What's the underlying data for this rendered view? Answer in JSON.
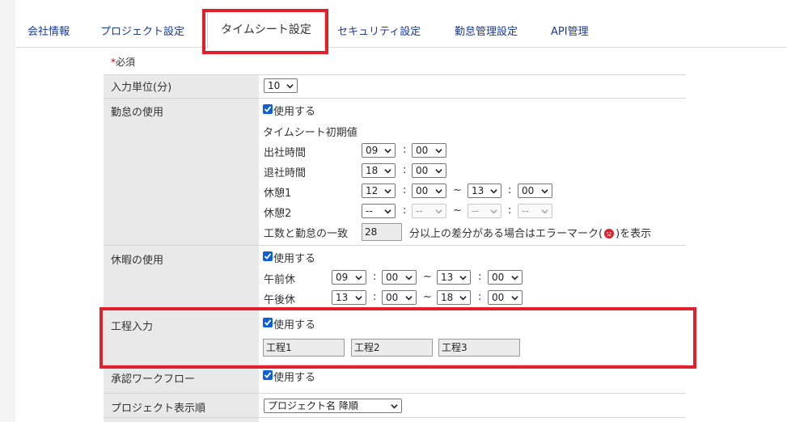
{
  "tabs": [
    {
      "label": "会社情報"
    },
    {
      "label": "プロジェクト設定"
    },
    {
      "label": "タイムシート設定"
    },
    {
      "label": "セキュリティ設定"
    },
    {
      "label": "勤怠管理設定"
    },
    {
      "label": "API管理"
    }
  ],
  "required_note": "必須",
  "required_mark": "*",
  "input_unit": {
    "label": "入力単位(分)",
    "value": "10"
  },
  "attendance": {
    "label": "勤怠の使用",
    "use_label": "使用する",
    "initial_title": "タイムシート初期値",
    "start": {
      "label": "出社時間",
      "h": "09",
      "m": "00"
    },
    "end": {
      "label": "退社時間",
      "h": "18",
      "m": "00"
    },
    "break1": {
      "label": "休憩1",
      "h1": "12",
      "m1": "00",
      "h2": "13",
      "m2": "00"
    },
    "break2": {
      "label": "休憩2",
      "h1": "--",
      "m1": "--",
      "h2": "--",
      "m2": "--"
    },
    "mismatch_label": "工数と勤怠の一致",
    "mismatch_value": "28",
    "mismatch_suffix_a": "分以上の差分がある場合はエラーマーク(",
    "mismatch_suffix_b": ")を表示"
  },
  "leave": {
    "label": "休暇の使用",
    "use_label": "使用する",
    "am": {
      "label": "午前休",
      "h1": "09",
      "m1": "00",
      "h2": "13",
      "m2": "00"
    },
    "pm": {
      "label": "午後休",
      "h1": "13",
      "m1": "00",
      "h2": "18",
      "m2": "00"
    }
  },
  "process": {
    "label": "工程入力",
    "use_label": "使用する",
    "fields": [
      "工程1",
      "工程2",
      "工程3"
    ]
  },
  "workflow": {
    "label": "承認ワークフロー",
    "use_label": "使用する"
  },
  "project_order": {
    "label": "プロジェクト表示順",
    "value": "プロジェクト名 降順"
  },
  "colors": {
    "highlight": "#e0202a",
    "tab_link": "#1a3a9c",
    "checkbox": "#0f5fd6"
  }
}
